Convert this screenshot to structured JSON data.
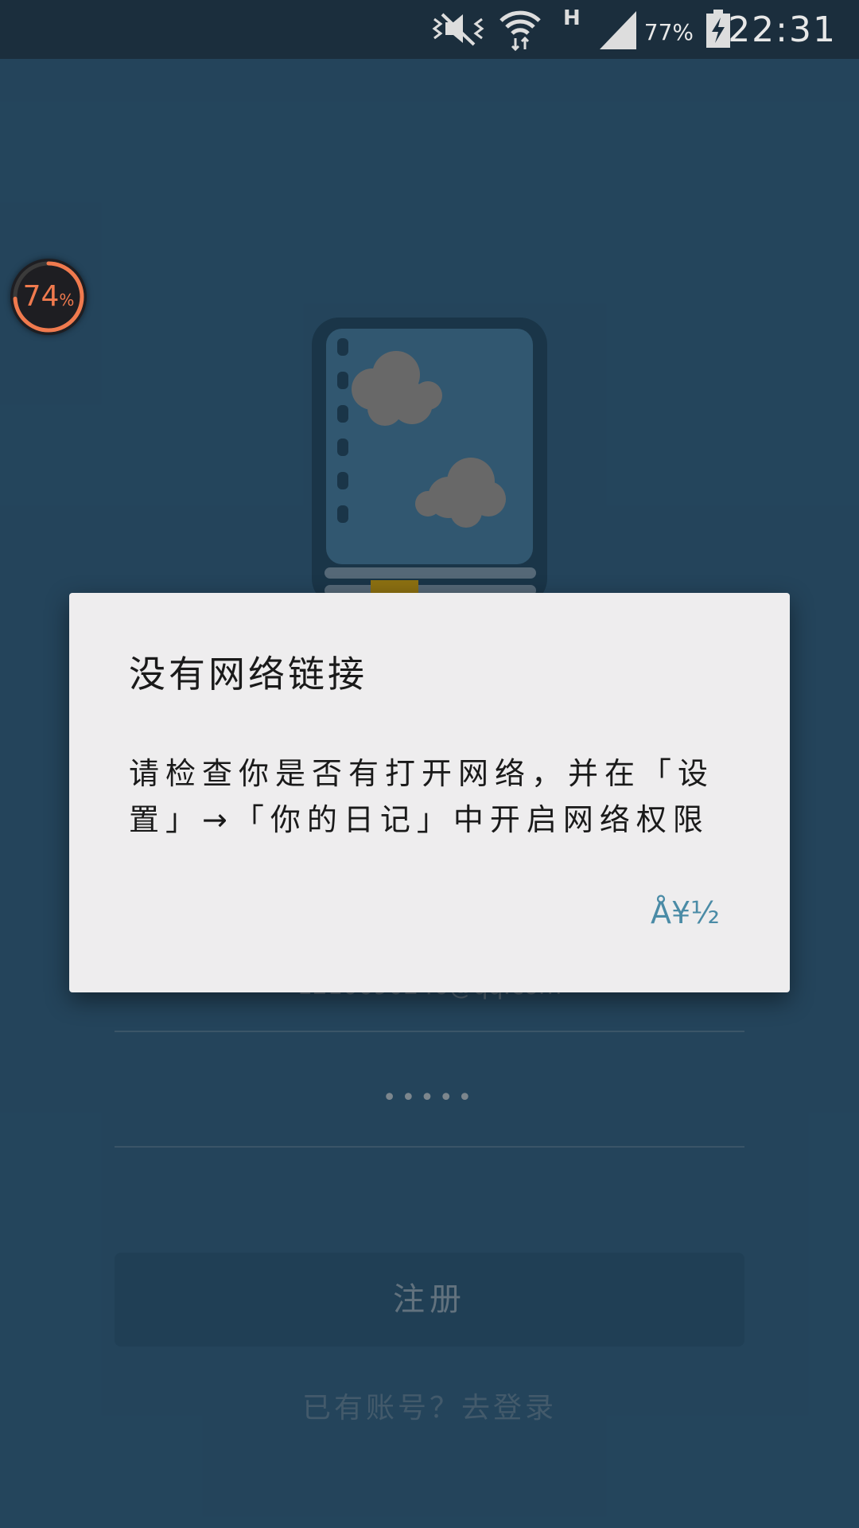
{
  "status_bar": {
    "time": "22:31",
    "battery_percent": "77%",
    "network_type": "H",
    "icons": [
      "mute-vibrate-icon",
      "wifi-icon",
      "signal-icon",
      "battery-charging-icon"
    ]
  },
  "floating_meter": {
    "value": "74",
    "unit": "%",
    "fraction": 0.74
  },
  "form": {
    "email": "1210690240@qq.com",
    "password_mask": "•••••",
    "register_label": "注册",
    "login_link": "已有账号？去登录"
  },
  "dialog": {
    "title": "没有网络链接",
    "message": "请检查你是否有打开网络，并在「设置」→「你的日记」中开启网络权限",
    "ok_label": "Å¥½"
  },
  "colors": {
    "background": "#3a6f94",
    "status_bar": "#1b2e3d",
    "dialog_bg": "#eeedee",
    "accent": "#4a8ba6",
    "meter": "#f07a4e"
  }
}
